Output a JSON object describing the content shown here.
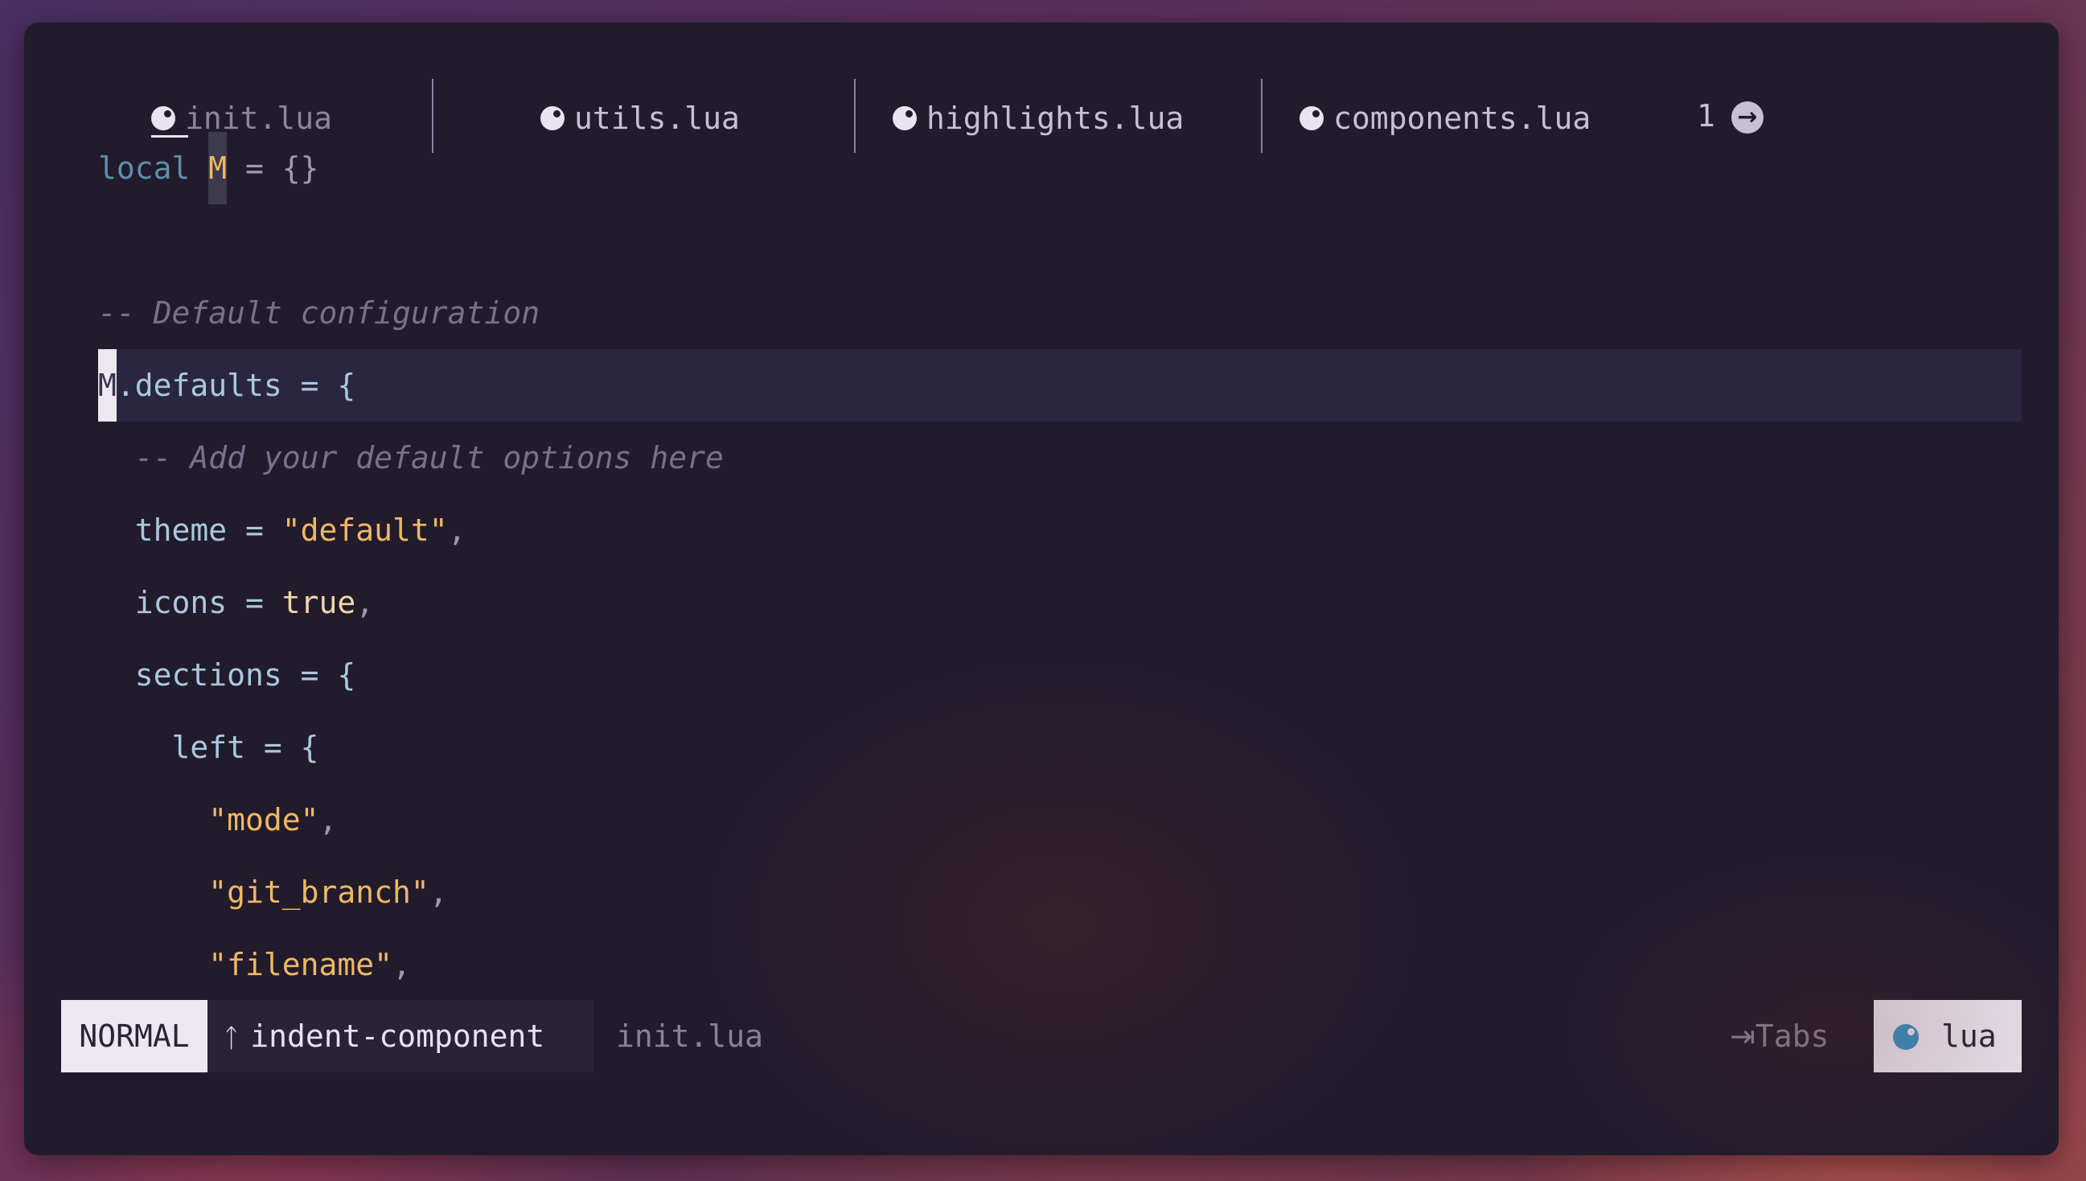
{
  "tabs": [
    {
      "name": "init.lua",
      "icon": "lua-icon",
      "active": true
    },
    {
      "name": "utils.lua",
      "icon": "lua-icon",
      "active": false
    },
    {
      "name": "highlights.lua",
      "icon": "lua-icon",
      "active": false
    },
    {
      "name": "components.lua",
      "icon": "lua-icon",
      "active": false
    }
  ],
  "tab_overflow": {
    "count": "1",
    "icon": "arrow-right-circle-icon"
  },
  "code": {
    "l1": {
      "kw": "local",
      "id": "M",
      "rest": " = {}"
    },
    "l3": "-- Default configuration",
    "l4": {
      "cursor": "M",
      "rest": ".defaults = {"
    },
    "l5": "  -- Add your default options here",
    "l6": {
      "key": "  theme = ",
      "val": "\"default\"",
      "tail": ","
    },
    "l7": {
      "key": "  icons = ",
      "val": "true",
      "tail": ","
    },
    "l8": "  sections = {",
    "l9": "    left = {",
    "l10": {
      "val": "      \"mode\"",
      "tail": ","
    },
    "l11": {
      "val": "      \"git_branch\"",
      "tail": ","
    },
    "l12": {
      "val": "      \"filename\"",
      "tail": ","
    }
  },
  "statusline": {
    "mode": "NORMAL",
    "branch_icon": "git-branch-icon",
    "branch": "indent-component",
    "file": "init.lua",
    "indent_icon": "tab-arrow-icon",
    "indent": "Tabs",
    "filetype_icon": "lua-icon",
    "filetype": "lua"
  },
  "colors": {
    "background": "#211b2c",
    "keyword": "#5f8fa8",
    "identifier": "#a9c9dd",
    "string": "#f0b864",
    "comment": "#77718a",
    "mode_bg": "#ece8f2",
    "lua_blue": "#3b8fc4"
  }
}
